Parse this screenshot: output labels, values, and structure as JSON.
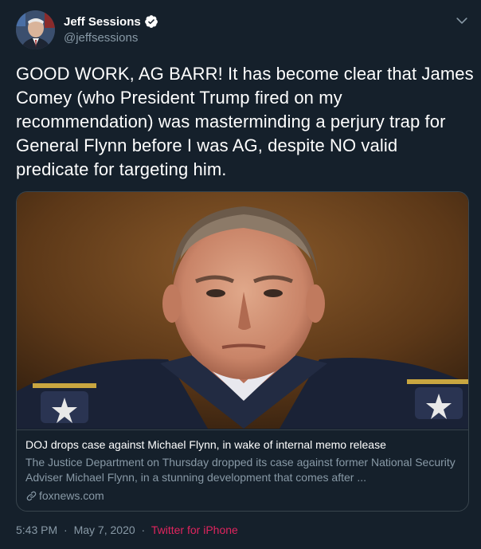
{
  "author": {
    "display_name": "Jeff Sessions",
    "handle": "@jeffsessions",
    "verified": true
  },
  "tweet": {
    "text": "GOOD WORK, AG BARR! It has become clear that James Comey (who President Trump fired on my recommendation) was masterminding a perjury trap for General Flynn before I was AG, despite NO valid predicate for targeting him."
  },
  "link_card": {
    "title": "DOJ drops case against Michael Flynn, in wake of internal memo release",
    "description": "The Justice Department on Thursday dropped its case against former National Security Adviser Michael Flynn, in a stunning development that comes after ...",
    "domain": "foxnews.com"
  },
  "meta": {
    "time": "5:43 PM",
    "separator": "·",
    "date": "May 7, 2020",
    "source": "Twitter for iPhone"
  },
  "icons": {
    "verified": "verified-badge-icon",
    "caret": "chevron-down-icon",
    "link": "link-icon"
  },
  "colors": {
    "background": "#15202b",
    "text": "#ffffff",
    "secondary_text": "#8899a6",
    "border": "#38444d",
    "verified_badge": "#ffffff",
    "source_link": "#e0245e"
  }
}
